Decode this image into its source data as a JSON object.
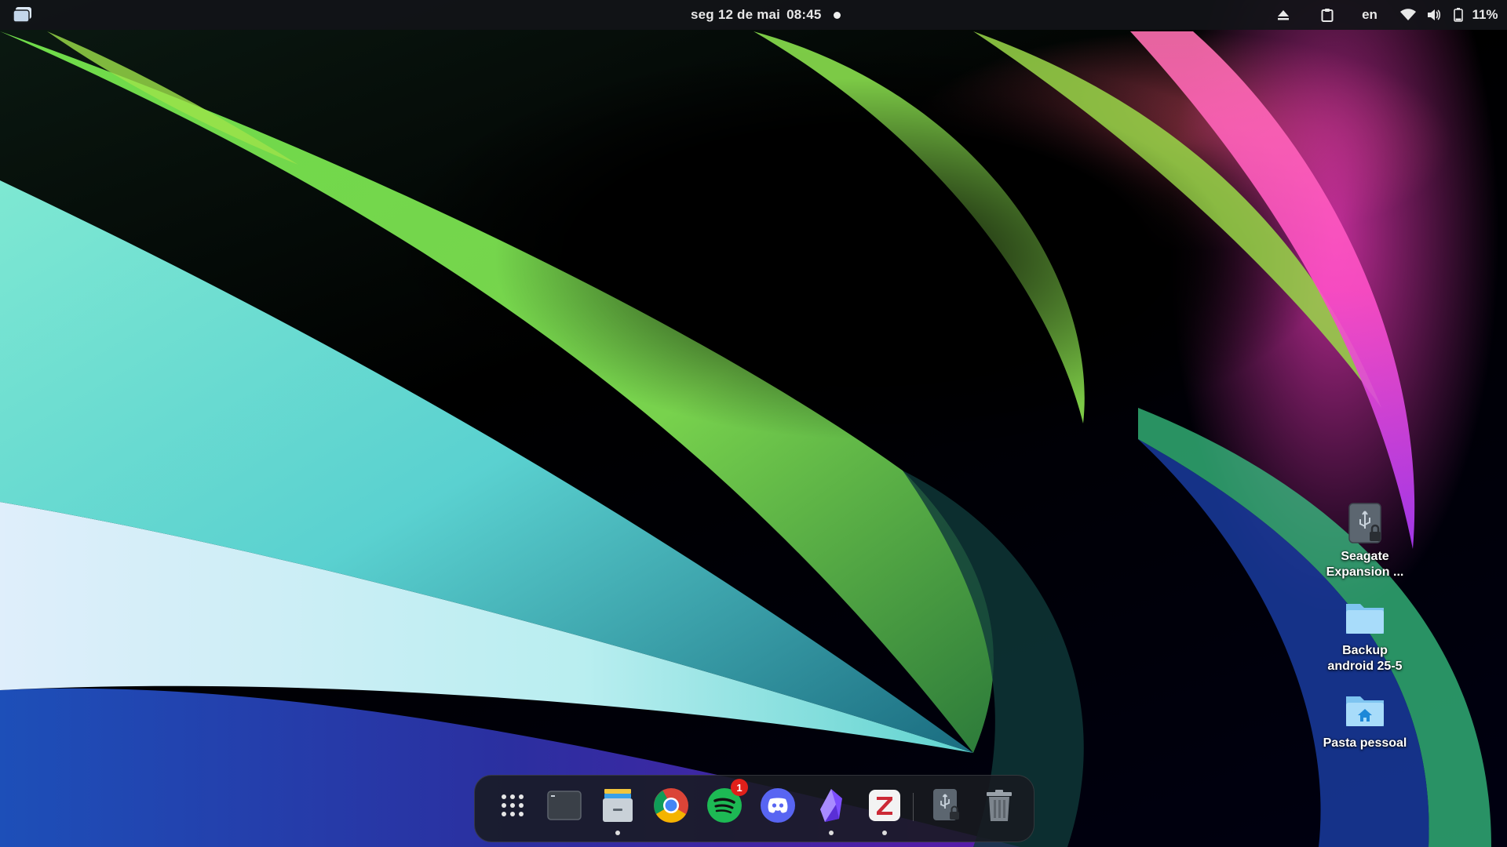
{
  "topbar": {
    "date": "seg 12 de mai",
    "time": "08:45",
    "language": "en",
    "battery_percent": "11%",
    "icons": [
      "activities-icon",
      "eject-icon",
      "clipboard-icon",
      "wifi-icon",
      "volume-icon",
      "battery-icon"
    ]
  },
  "desktop": {
    "icons": [
      {
        "label_line1": "Seagate",
        "label_line2": "Expansion ...",
        "icon": "usb-drive-icon"
      },
      {
        "label_line1": "Backup",
        "label_line2": "android 25-5",
        "icon": "folder-icon"
      },
      {
        "label_line1": "Pasta pessoal",
        "icon": "home-folder-icon"
      }
    ]
  },
  "dock": {
    "items": [
      "app-grid-icon",
      "terminal-icon",
      "files-icon",
      "chrome-icon",
      "spotify-icon",
      "discord-icon",
      "obsidian-icon",
      "zotero-icon",
      "usb-drive-icon",
      "trash-icon"
    ],
    "spotify_badge": "1",
    "colors": {
      "spotify": "#1db954",
      "discord": "#5865f2",
      "obsidian": "#7c4dff",
      "zotero": "#cc2936",
      "badge": "#e0201a"
    }
  }
}
